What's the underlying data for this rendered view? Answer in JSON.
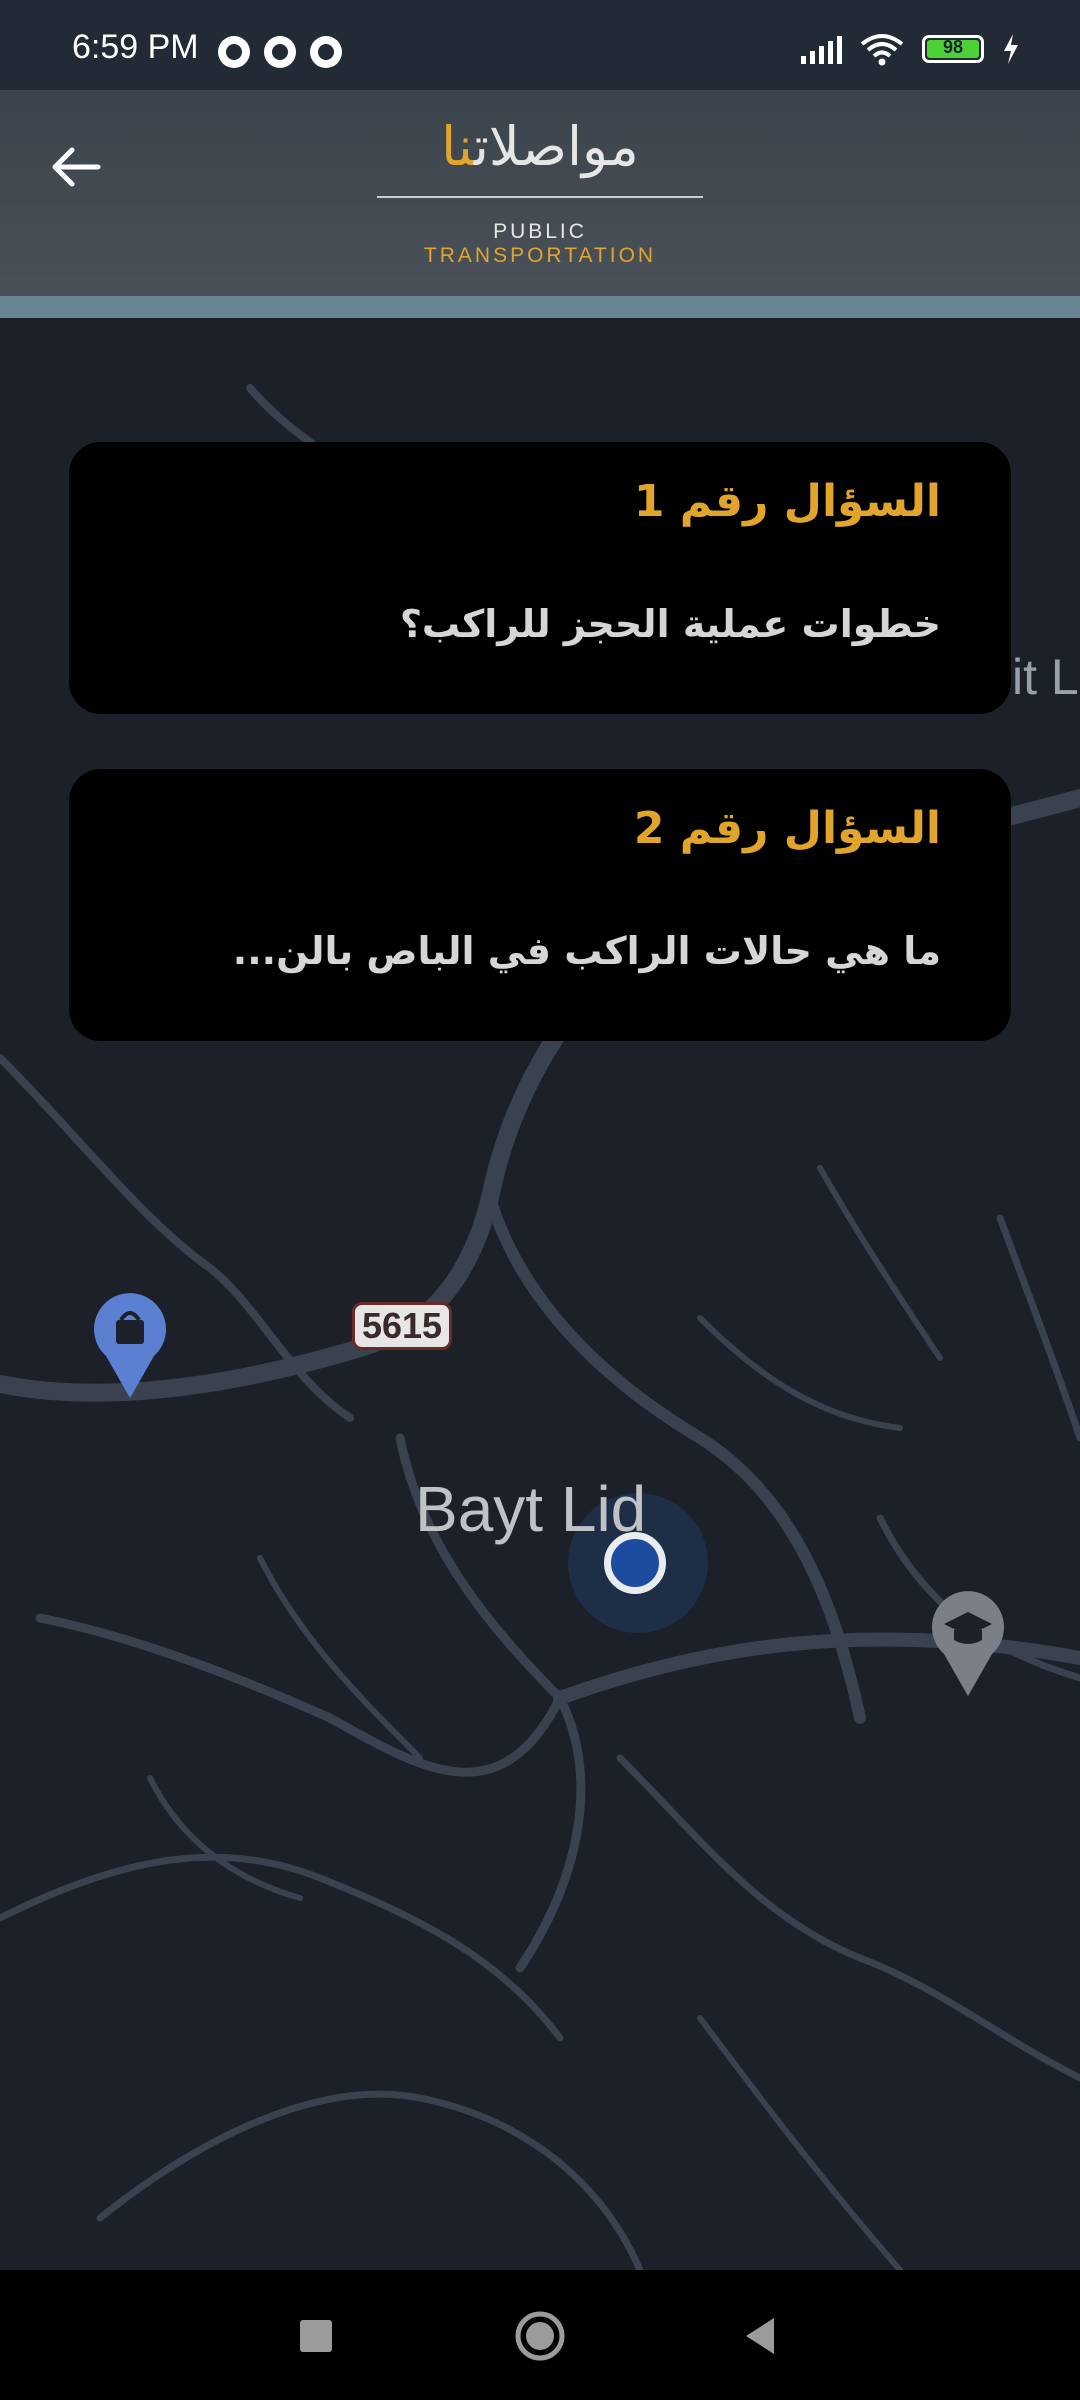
{
  "status_bar": {
    "time": "6:59 PM",
    "battery_level": "98",
    "icons": [
      "messenger-icon",
      "notification-icon",
      "notification-icon",
      "signal-icon",
      "wifi-icon",
      "battery-icon",
      "charging-icon"
    ]
  },
  "header": {
    "back_icon": "arrow-left-icon",
    "logo_ar_main": "مواصلات",
    "logo_ar_accent": "نا",
    "logo_en_main": "PUBLIC ",
    "logo_en_accent": "TRANSPORTATION"
  },
  "questions": [
    {
      "title": "السؤال رقم 1",
      "text": "خطوات عملية الحجز للراكب؟"
    },
    {
      "title": "السؤال رقم 2",
      "text": "ما  هي حالات الراكب في الباص بالن..."
    }
  ],
  "map": {
    "place_label": "Bayt Lid",
    "road_number": "5615",
    "partial_label": "it L",
    "pins": [
      "shopping-bag-pin-icon",
      "school-pin-icon"
    ]
  },
  "nav_bar": {
    "icons": [
      "recents-square-icon",
      "home-circle-icon",
      "back-triangle-icon"
    ]
  },
  "colors": {
    "accent": "#e2a52c",
    "map_bg": "#1b2029",
    "road": "#3a4250",
    "header": "#3b434c"
  }
}
